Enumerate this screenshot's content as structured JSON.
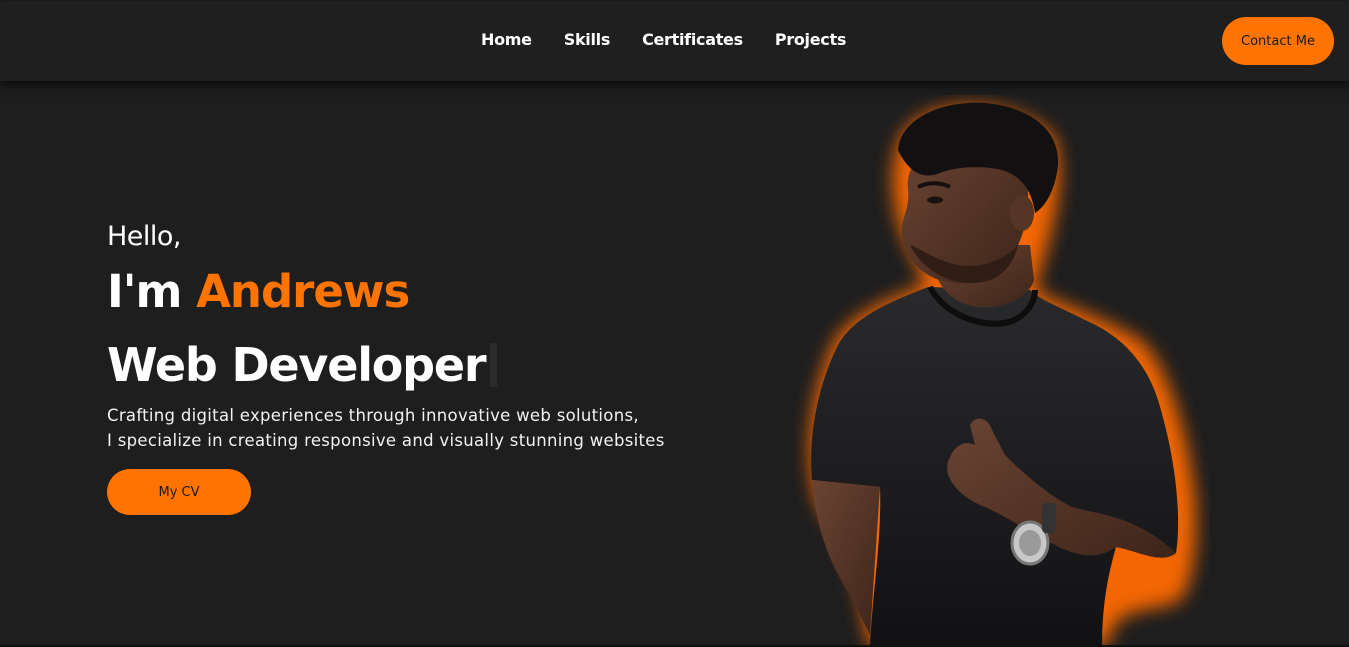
{
  "nav": {
    "links": [
      "Home",
      "Skills",
      "Certificates",
      "Projects"
    ],
    "contact_label": "Contact Me"
  },
  "hero": {
    "greeting": "Hello,",
    "intro_prefix": "I'm ",
    "name": "Andrews",
    "role": "Web Developer",
    "description_line1": "Crafting digital experiences through innovative web solutions,",
    "description_line2": "I specialize in creating responsive and visually stunning websites",
    "cv_label": "My CV"
  },
  "colors": {
    "background": "#1e1e1e",
    "navbar": "#1f1f1f",
    "accent": "#ff7300",
    "text": "#ffffff"
  }
}
